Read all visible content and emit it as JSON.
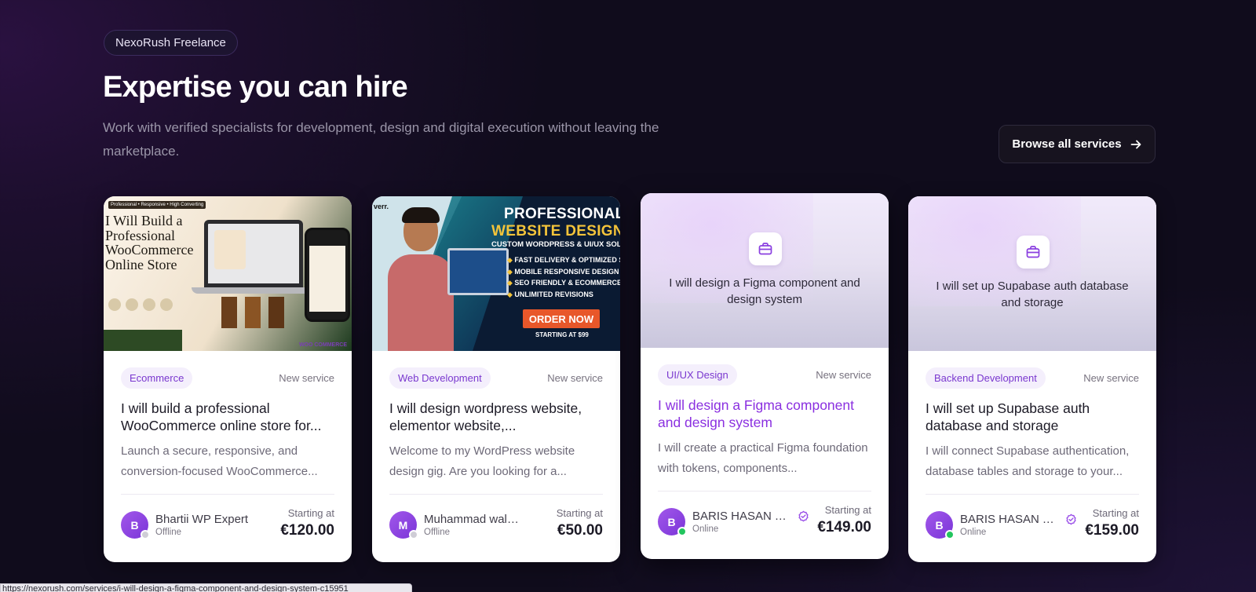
{
  "header": {
    "badge": "NexoRush Freelance",
    "title": "Expertise you can hire",
    "subtitle": "Work with verified specialists for development, design and digital execution without leaving the marketplace.",
    "browse_label": "Browse all services"
  },
  "cards": [
    {
      "media_type": "banner-woocommerce",
      "banner": {
        "small": "Professional • Responsive • High Converting",
        "title": "I Will Build a Professional WooCommerce Online Store",
        "label": "WOO COMMERCE"
      },
      "category": "Ecommerce",
      "tag": "New service",
      "title": "I will build a professional WooCommerce online store for...",
      "description": "Launch a secure, responsive, and conversion-focused WooCommerce...",
      "seller": {
        "initial": "B",
        "name": "Bhartii WP Expert",
        "status": "Offline",
        "verified": false
      },
      "price_label": "Starting at",
      "price": "€120.00"
    },
    {
      "media_type": "banner-wordpress",
      "banner": {
        "brand": "verr.",
        "line1": "PROFESSIONAL",
        "line2": "WEBSITE DESIGNER",
        "line3": "CUSTOM WORDPRESS & UI/UX SOLUTIONS",
        "features": [
          "FAST DELIVERY & OPTIMIZED SITE",
          "MOBILE RESPONSIVE DESIGN",
          "SEO FRIENDLY & ECOMMERCE",
          "UNLIMITED REVISIONS"
        ],
        "cta": "ORDER NOW",
        "starting": "STARTING AT $99"
      },
      "category": "Web Development",
      "tag": "New service",
      "title": "I will design wordpress website, elementor website,...",
      "description": "Welcome to my WordPress website design gig. Are you looking for a...",
      "seller": {
        "initial": "M",
        "name": "Muhammad waleed",
        "status": "Offline",
        "verified": false
      },
      "price_label": "Starting at",
      "price": "€50.00"
    },
    {
      "media_type": "placeholder",
      "placeholder_text": "I will design a Figma component and design system",
      "category": "UI/UX Design",
      "tag": "New service",
      "title": "I will design a Figma component and design system",
      "description": "I will create a practical Figma foundation with tokens, components...",
      "seller": {
        "initial": "B",
        "name": "BARIS HASAN TO...",
        "status": "Online",
        "verified": true
      },
      "price_label": "Starting at",
      "price": "€149.00"
    },
    {
      "media_type": "placeholder",
      "placeholder_text": "I will set up Supabase auth database and storage",
      "category": "Backend Development",
      "tag": "New service",
      "title": "I will set up Supabase auth database and storage",
      "description": "I will connect Supabase authentication, database tables and storage to your...",
      "seller": {
        "initial": "B",
        "name": "BARIS HASAN TO...",
        "status": "Online",
        "verified": true
      },
      "price_label": "Starting at",
      "price": "€159.00"
    }
  ],
  "status_bar": {
    "url": "https://nexorush.com/services/i-will-design-a-figma-component-and-design-system-c15951"
  },
  "colors": {
    "accent": "#7a38cf",
    "hover_title": "#8a2fe0",
    "online": "#22c55e",
    "offline": "#cfcdd6",
    "background": "#100c1c"
  },
  "icons": {
    "browse_arrow": "arrow-right-icon",
    "placeholder": "briefcase-icon",
    "verified": "verified-check-icon"
  }
}
